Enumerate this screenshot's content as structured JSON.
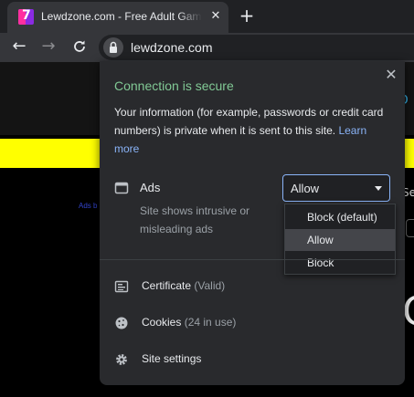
{
  "browser": {
    "tab": {
      "title": "Lewdzone.com - Free Adult Games"
    },
    "url": "lewdzone.com"
  },
  "popup": {
    "title": "Connection is secure",
    "description": "Your information (for example, passwords or credit card numbers) is private when it is sent to this site.",
    "learn_more": "Learn more",
    "ads": {
      "label": "Ads",
      "description": "Site shows intrusive or misleading ads",
      "selected": "Allow",
      "options": [
        "Block (default)",
        "Allow",
        "Block"
      ]
    },
    "certificate": {
      "label": "Certificate",
      "note": "(Valid)"
    },
    "cookies": {
      "label": "Cookies",
      "note": "(24 in use)"
    },
    "site_settings": {
      "label": "Site settings"
    }
  },
  "page": {
    "ads_link": "Ads b",
    "right_peek_se": "Se",
    "right_peek_c": "C"
  },
  "colors": {
    "secure_green": "#81c995",
    "link_blue": "#8ab4f8",
    "page_yellow": "#ffff00"
  }
}
